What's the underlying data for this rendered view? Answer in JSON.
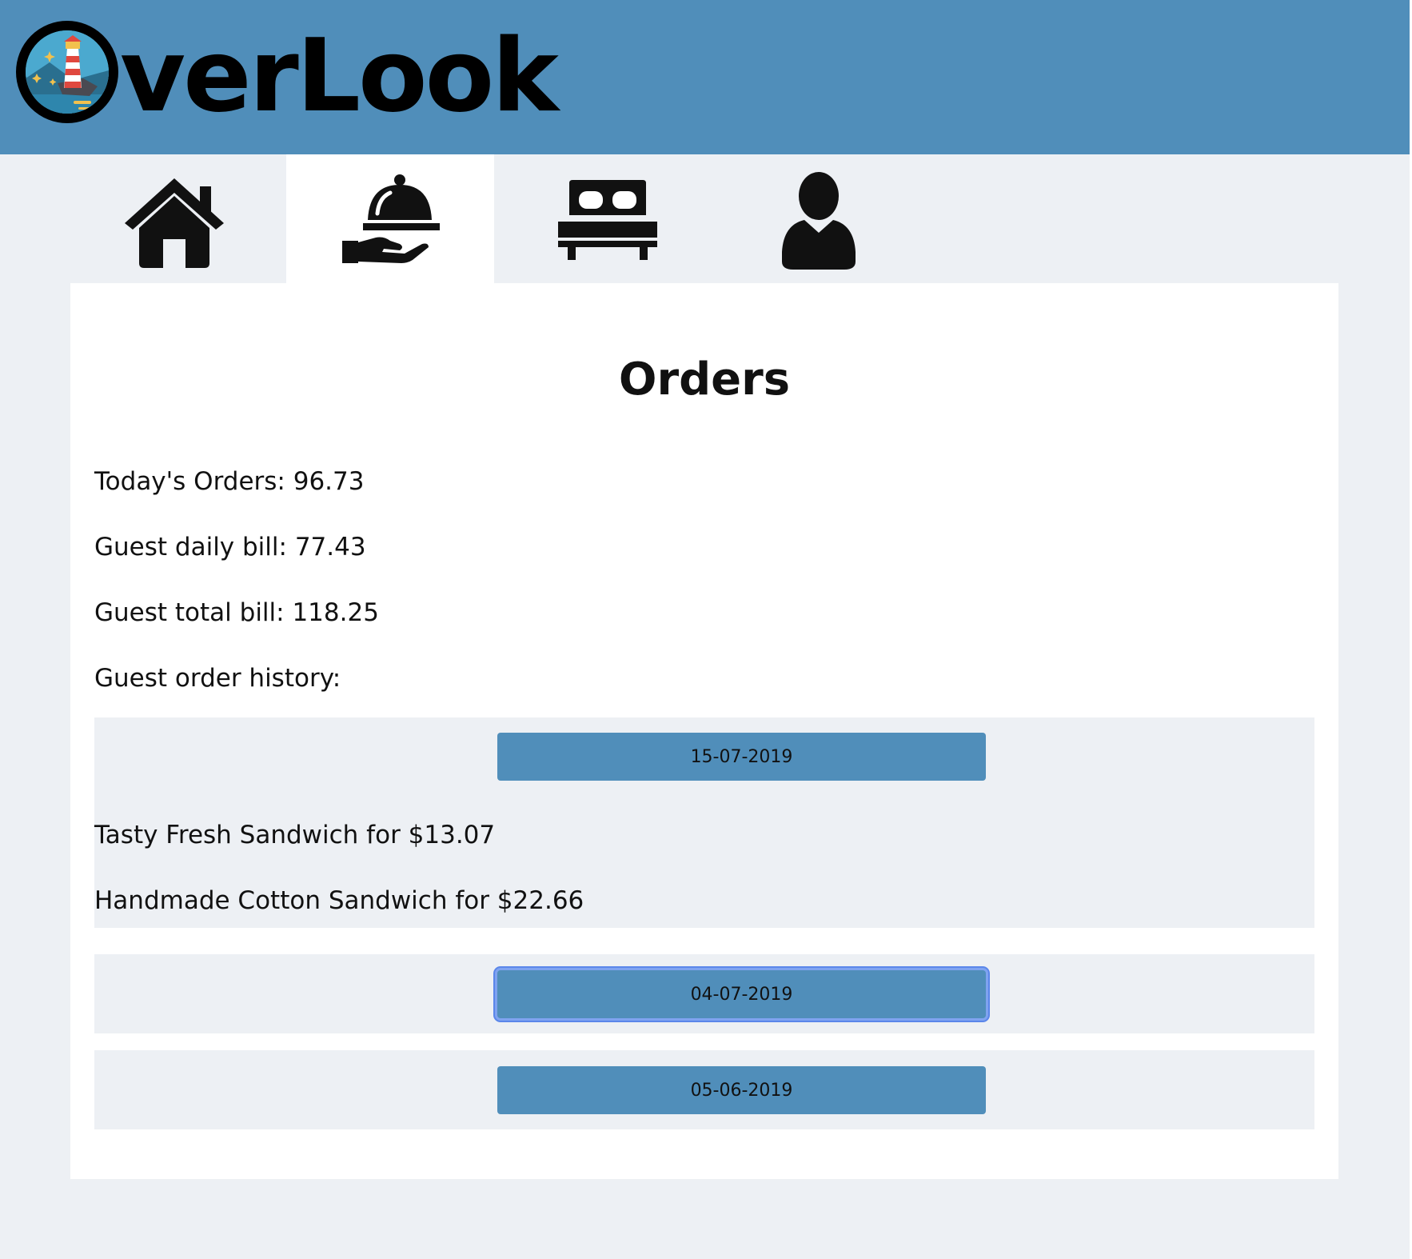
{
  "app": {
    "logo_text": "verLook"
  },
  "nav": {
    "tabs": [
      {
        "icon": "home-icon",
        "active": false
      },
      {
        "icon": "room-service-icon",
        "active": true
      },
      {
        "icon": "bed-icon",
        "active": false
      },
      {
        "icon": "user-icon",
        "active": false
      }
    ]
  },
  "orders": {
    "title": "Orders",
    "todays_orders": "Today's Orders: 96.73",
    "guest_daily_bill": "Guest daily bill: 77.43",
    "guest_total_bill": "Guest total bill: 118.25",
    "history_label": "Guest order history:",
    "history": [
      {
        "date": "15-07-2019",
        "expanded": true,
        "items": [
          "Tasty Fresh Sandwich for $13.07",
          "Handmade Cotton Sandwich for $22.66"
        ]
      },
      {
        "date": "04-07-2019",
        "expanded": false,
        "focused": true,
        "items": []
      },
      {
        "date": "05-06-2019",
        "expanded": false,
        "items": []
      }
    ]
  },
  "colors": {
    "header": "#508eba",
    "page_bg": "#edf0f4",
    "panel_bg": "#ffffff",
    "button": "#508eba",
    "focus_ring": "#5b86ea"
  }
}
